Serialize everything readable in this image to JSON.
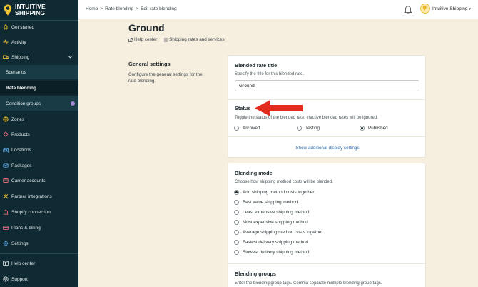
{
  "brand": {
    "name_line1": "INTUITIVE",
    "name_line2": "SHIPPING",
    "accent": "#f2c331"
  },
  "sidebar": {
    "items": [
      {
        "label": "Get started",
        "icon": "rocket-icon"
      },
      {
        "label": "Activity",
        "icon": "activity-icon"
      },
      {
        "label": "Shipping",
        "icon": "shipping-icon"
      },
      {
        "label": "Scenarios"
      },
      {
        "label": "Rate blending"
      },
      {
        "label": "Condition groups"
      },
      {
        "label": "Zones",
        "icon": "zones-icon"
      },
      {
        "label": "Products",
        "icon": "products-icon"
      },
      {
        "label": "Locations",
        "icon": "locations-icon"
      },
      {
        "label": "Packages",
        "icon": "packages-icon"
      },
      {
        "label": "Carrier accounts",
        "icon": "carrier-icon"
      },
      {
        "label": "Partner integrations",
        "icon": "partner-icon"
      },
      {
        "label": "Shopify connection",
        "icon": "shopify-icon"
      },
      {
        "label": "Plans & billing",
        "icon": "billing-icon"
      },
      {
        "label": "Settings",
        "icon": "gear-icon"
      },
      {
        "label": "Help center",
        "icon": "help-icon"
      },
      {
        "label": "Support",
        "icon": "support-icon"
      }
    ]
  },
  "topbar": {
    "breadcrumb": [
      "Home",
      ">",
      "Rate blending",
      ">",
      "Edit rate blending"
    ],
    "account": "Intuitive Shipping"
  },
  "page": {
    "title": "Ground",
    "help_link": "Help center",
    "rates_link": "Shipping rates and services"
  },
  "general": {
    "title": "General settings",
    "desc": "Configure the general settings for the rate blending."
  },
  "card1": {
    "title_label": "Blended rate title",
    "title_help": "Specify the title for this blended rate.",
    "title_value": "Ground",
    "status_label": "Status",
    "status_help": "Toggle the status of the blended rate. Inactive blended rates will be ignored.",
    "status_options": [
      "Archived",
      "Testing",
      "Published"
    ],
    "status_selected": "Published",
    "more_link": "Show additional display settings"
  },
  "card2": {
    "mode_label": "Blending mode",
    "mode_help": "Choose how shipping method costs will be blended.",
    "mode_options": [
      "Add shipping method costs together",
      "Best value shipping method",
      "Least expensive shipping method",
      "Most expensive shipping method",
      "Average shipping method costs together",
      "Fastest delivery shipping method",
      "Slowest delivery shipping method"
    ],
    "mode_selected": "Add shipping method costs together",
    "groups_label": "Blending groups",
    "groups_help": "Enter the blending group tags. Comma separate multiple blending group tags."
  },
  "annotation": {
    "arrow_color": "#e32b1e"
  }
}
